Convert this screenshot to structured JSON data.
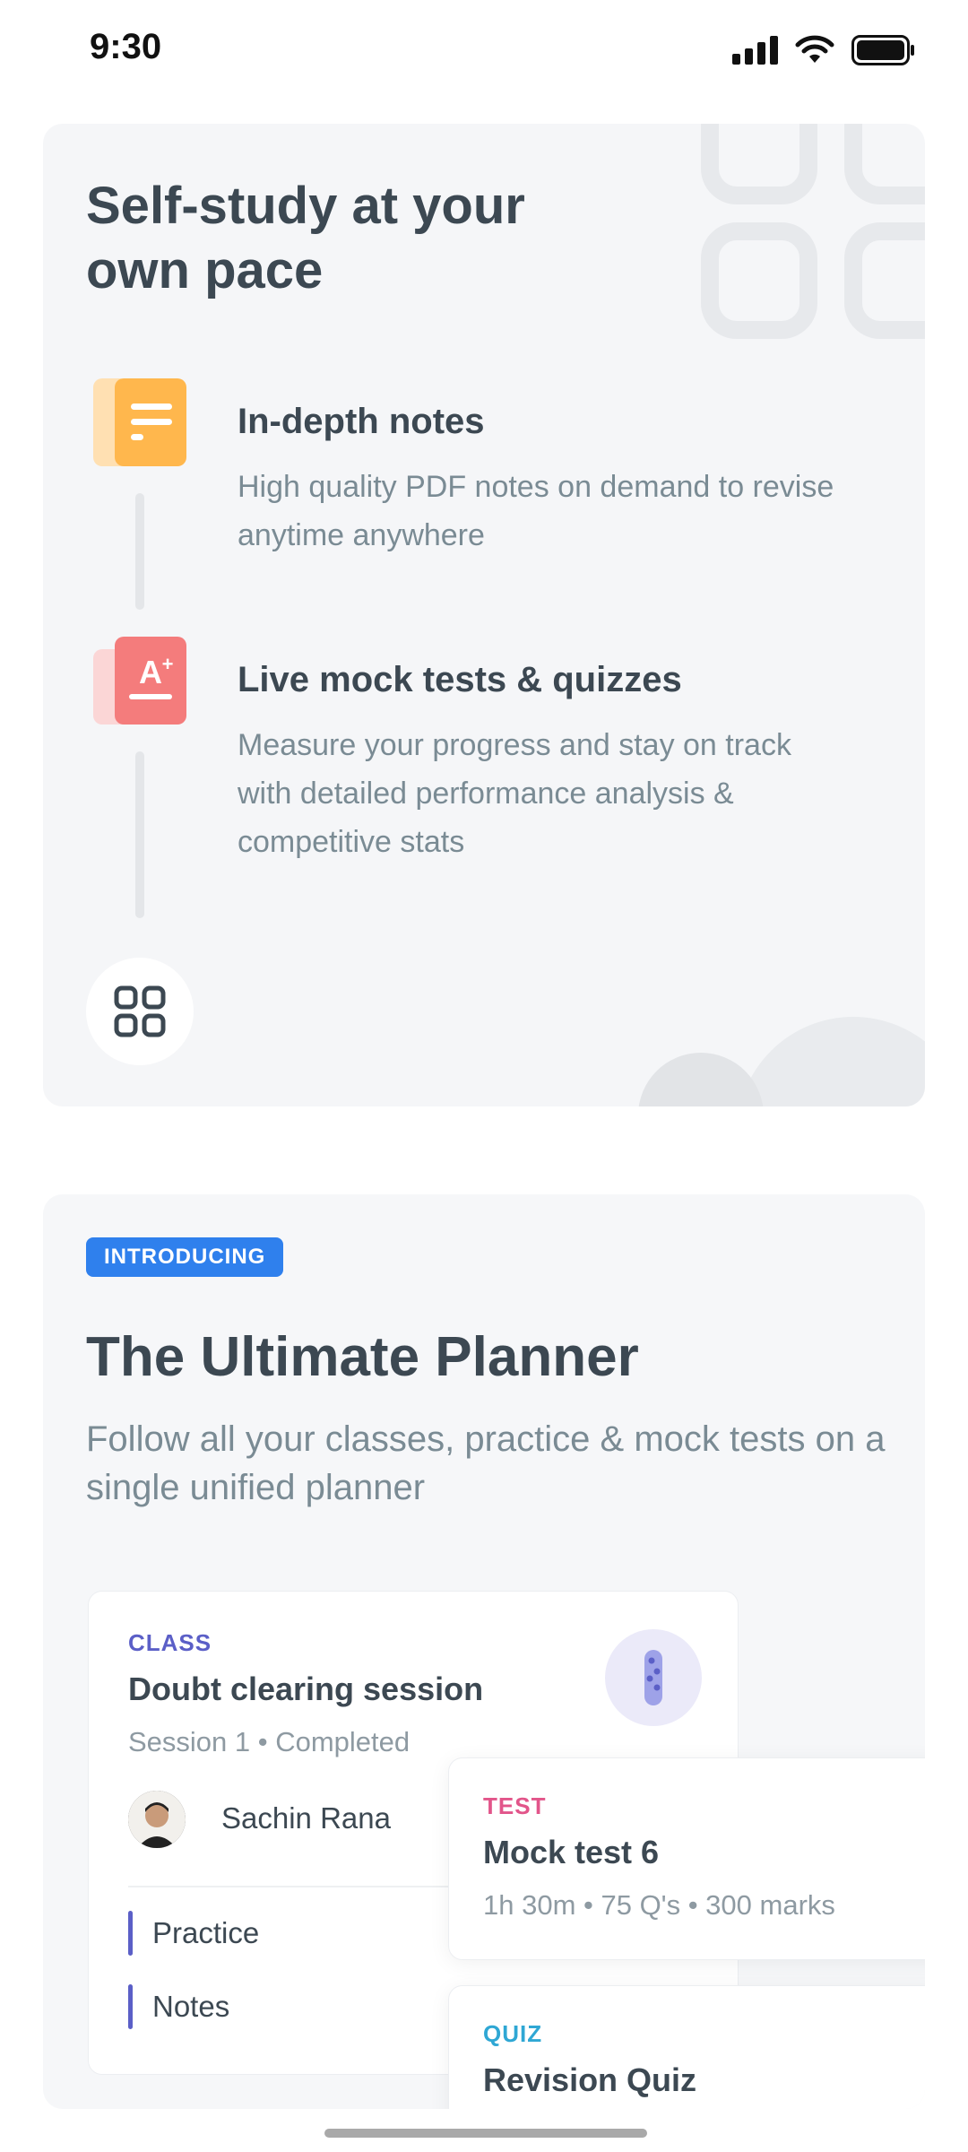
{
  "status_bar": {
    "time": "9:30"
  },
  "self_study": {
    "title": "Self-study at your own pace",
    "features": [
      {
        "title": "In-depth notes",
        "description": "High quality PDF notes on demand to revise anytime anywhere",
        "icon": "notes-icon",
        "color": "#ffb74d"
      },
      {
        "title": "Live mock tests & quizzes",
        "description": "Measure your progress and stay on track with detailed performance analysis & competitive stats",
        "icon": "grade-icon",
        "color": "#f47c7c"
      }
    ],
    "bottom_icon": "grid-icon"
  },
  "planner": {
    "badge": "INTRODUCING",
    "title": "The Ultimate Planner",
    "description": "Follow all your classes, practice & mock tests on a single unified planner",
    "class_card": {
      "tag": "CLASS",
      "title": "Doubt clearing session",
      "meta": "Session 1 • Completed",
      "teacher": "Sachin Rana",
      "items": [
        "Practice",
        "Notes"
      ]
    },
    "test_card": {
      "tag": "TEST",
      "title": "Mock test 6",
      "meta": "1h 30m • 75 Q's • 300 marks"
    },
    "quiz_card": {
      "tag": "QUIZ",
      "title": "Revision Quiz"
    }
  },
  "colors": {
    "badge": "#2f80ed",
    "class_tag": "#5b5fc7",
    "test_tag": "#e2558a",
    "quiz_tag": "#2fa7d4"
  }
}
